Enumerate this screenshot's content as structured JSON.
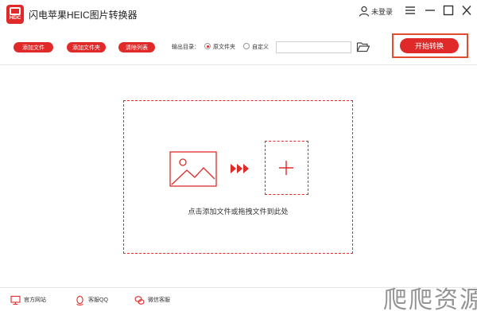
{
  "app": {
    "logo_text": "HEIC",
    "title": "闪电苹果HEIC图片转换器",
    "user_label": "未登录"
  },
  "toolbar": {
    "add_file_label": "添加文件",
    "add_folder_label": "添加文件夹",
    "clear_list_label": "清除列表",
    "output_dir_label": "输出目录：",
    "option_source_label": "原文件夹",
    "option_custom_label": "自定义",
    "selected_option": "原文件夹",
    "path_value": "",
    "start_label": "开始转换"
  },
  "dropzone": {
    "hint": "点击添加文件或拖拽文件到此处"
  },
  "footer": {
    "site_label": "官方网站",
    "qq_label": "客服QQ",
    "wechat_label": "微信客服"
  },
  "watermark": {
    "text": "爬爬资源"
  },
  "icons": [
    "app-logo-icon",
    "user-icon",
    "menu-icon",
    "minimize-icon",
    "maximize-icon",
    "close-icon",
    "folder-open-icon",
    "image-icon",
    "arrows-right-icon",
    "plus-icon",
    "monitor-icon",
    "qq-icon",
    "wechat-icon"
  ],
  "colors": {
    "accent": "#e02a2a",
    "highlight_frame": "#e04d2f"
  }
}
